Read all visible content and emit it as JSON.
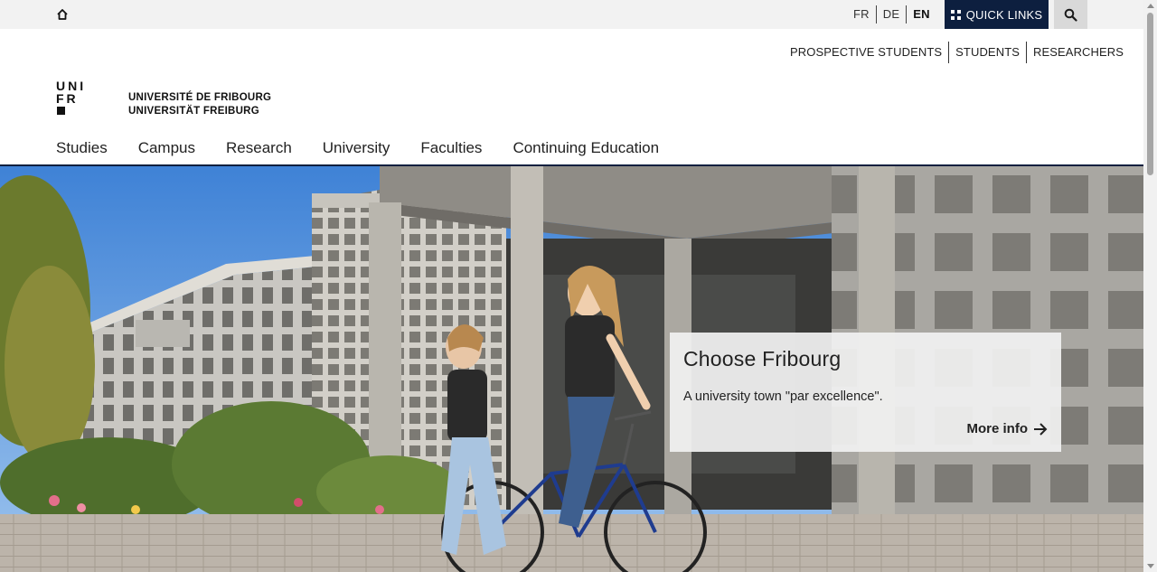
{
  "topbar": {
    "home_icon": "home-icon",
    "languages": [
      {
        "code": "FR",
        "active": false
      },
      {
        "code": "DE",
        "active": false
      },
      {
        "code": "EN",
        "active": true
      }
    ],
    "quick_links_label": "QUICK LINKS",
    "quick_links_icon": "grid-icon",
    "search_icon": "search-icon",
    "accent_color": "#0d1f3f"
  },
  "audience": {
    "items": [
      "PROSPECTIVE STUDENTS",
      "STUDENTS",
      "RESEARCHERS"
    ]
  },
  "logo": {
    "mark_lines": [
      "UNI",
      "FR"
    ],
    "name_fr": "UNIVERSITÉ DE FRIBOURG",
    "name_de": "UNIVERSITÄT FREIBURG"
  },
  "nav": {
    "items": [
      "Studies",
      "Campus",
      "Research",
      "University",
      "Faculties",
      "Continuing Education"
    ]
  },
  "hero": {
    "image": "Two students on a bicycle in front of a university building",
    "promo": {
      "title": "Choose Fribourg",
      "text": "A university town \"par excellence\".",
      "link": "More info",
      "link_icon": "arrow-right-icon"
    }
  }
}
